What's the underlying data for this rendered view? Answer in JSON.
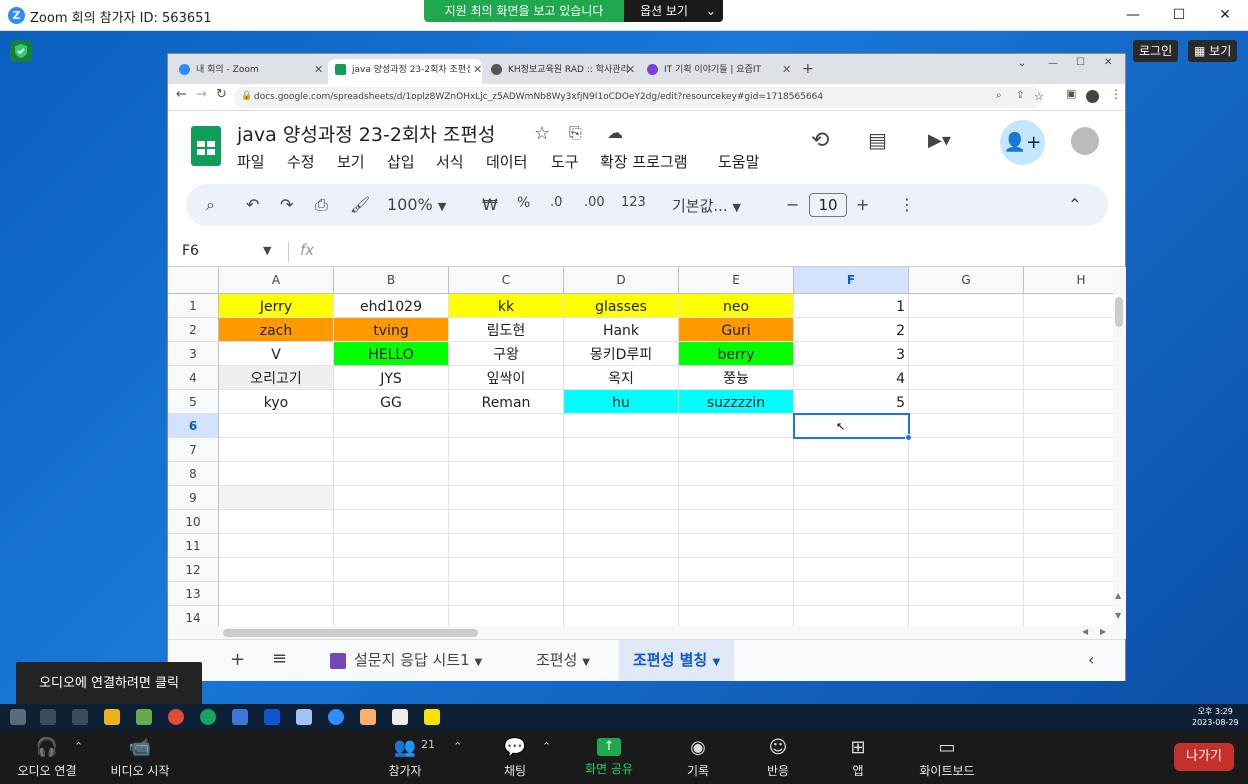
{
  "zoom": {
    "title": "Zoom 회의 참가자 ID: 563651",
    "share_banner": "지원 최의 화면을 보고 있습니다",
    "view_options": "옵션 보기",
    "login": "로그인",
    "view": "보기"
  },
  "browser": {
    "tabs": [
      {
        "label": "내 회의 - Zoom",
        "icon_color": "#2d8cff"
      },
      {
        "label": "java 양성과정 23-2회차 조편성 -",
        "icon_color": "#0f9d58"
      },
      {
        "label": "KH정보교육원 RAD :: 학사관리",
        "icon_color": "#555555"
      },
      {
        "label": "IT 기획 이야기들 | 요즘IT",
        "icon_color": "#7b3fe4"
      }
    ],
    "url": "docs.google.com/spreadsheets/d/1oplz8WZnOHxLjc_z5ADWmNb8Wy3xfjN9l1oCDOeY2dg/edit?resourcekey#gid=1718565664"
  },
  "sheets": {
    "title": "java 양성과정 23-2회차 조편성",
    "menu": [
      "파일",
      "수정",
      "보기",
      "삽입",
      "서식",
      "데이터",
      "도구",
      "확장 프로그램",
      "도움말"
    ],
    "zoom_level": "100%",
    "currency": "₩",
    "percent": "%",
    "dec_decrease": ".0",
    "dec_increase": ".00",
    "number_format": "123",
    "font": "기본값...",
    "font_size": "10",
    "name_box": "F6",
    "fx": "fx",
    "columns": [
      "A",
      "B",
      "C",
      "D",
      "E",
      "F",
      "G",
      "H"
    ],
    "rows": [
      "1",
      "2",
      "3",
      "4",
      "5",
      "6",
      "7",
      "8",
      "9",
      "10",
      "11",
      "12",
      "13",
      "14"
    ],
    "cells": [
      [
        {
          "v": "Jerry",
          "bg": "#ffff00"
        },
        {
          "v": "ehd1029",
          "bg": ""
        },
        {
          "v": "kk",
          "bg": "#ffff00"
        },
        {
          "v": "glasses",
          "bg": "#ffff00"
        },
        {
          "v": "neo",
          "bg": "#ffff00"
        },
        {
          "v": "1",
          "bg": "",
          "num": true
        }
      ],
      [
        {
          "v": "zach",
          "bg": "#ff9900"
        },
        {
          "v": "tving",
          "bg": "#ff9900"
        },
        {
          "v": "림도현",
          "bg": ""
        },
        {
          "v": "Hank",
          "bg": ""
        },
        {
          "v": "Guri",
          "bg": "#ff9900"
        },
        {
          "v": "2",
          "bg": "",
          "num": true
        }
      ],
      [
        {
          "v": "V",
          "bg": ""
        },
        {
          "v": "HELLO",
          "bg": "#00ff00"
        },
        {
          "v": "구왕",
          "bg": ""
        },
        {
          "v": "몽키D루피",
          "bg": ""
        },
        {
          "v": "berry",
          "bg": "#00ff00"
        },
        {
          "v": "3",
          "bg": "",
          "num": true
        }
      ],
      [
        {
          "v": "오리고기",
          "bg": "#efefef"
        },
        {
          "v": "JYS",
          "bg": ""
        },
        {
          "v": "잎싹이",
          "bg": ""
        },
        {
          "v": "옥지",
          "bg": ""
        },
        {
          "v": "쭝늉",
          "bg": ""
        },
        {
          "v": "4",
          "bg": "",
          "num": true
        }
      ],
      [
        {
          "v": "kyo",
          "bg": ""
        },
        {
          "v": "GG",
          "bg": ""
        },
        {
          "v": "Reman",
          "bg": ""
        },
        {
          "v": "hu",
          "bg": "#00ffff"
        },
        {
          "v": "suzzzzin",
          "bg": "#00ffff"
        },
        {
          "v": "5",
          "bg": "",
          "num": true
        }
      ]
    ],
    "sheet_tabs": [
      "설문지 응답 시트1",
      "조편성",
      "조편성 별칭"
    ]
  },
  "tooltip": "오디오에 연결하려면 클릭",
  "clock": {
    "time": "오후 3:29",
    "date": "2023-08-29"
  },
  "controls": {
    "audio": "오디오 연결",
    "video": "비디오 시작",
    "participants": "참가자",
    "participants_count": "21",
    "chat": "채팅",
    "share": "화면 공유",
    "record": "기록",
    "reactions": "반응",
    "apps": "앱",
    "whiteboard": "화이트보드",
    "leave": "나가기"
  },
  "colors": {
    "zoom_blue": "#2d8cff",
    "share_green": "#1fa84e",
    "sheets_green": "#0f9d58",
    "select_blue": "#1a73e8",
    "leave_red": "#c4302b"
  }
}
